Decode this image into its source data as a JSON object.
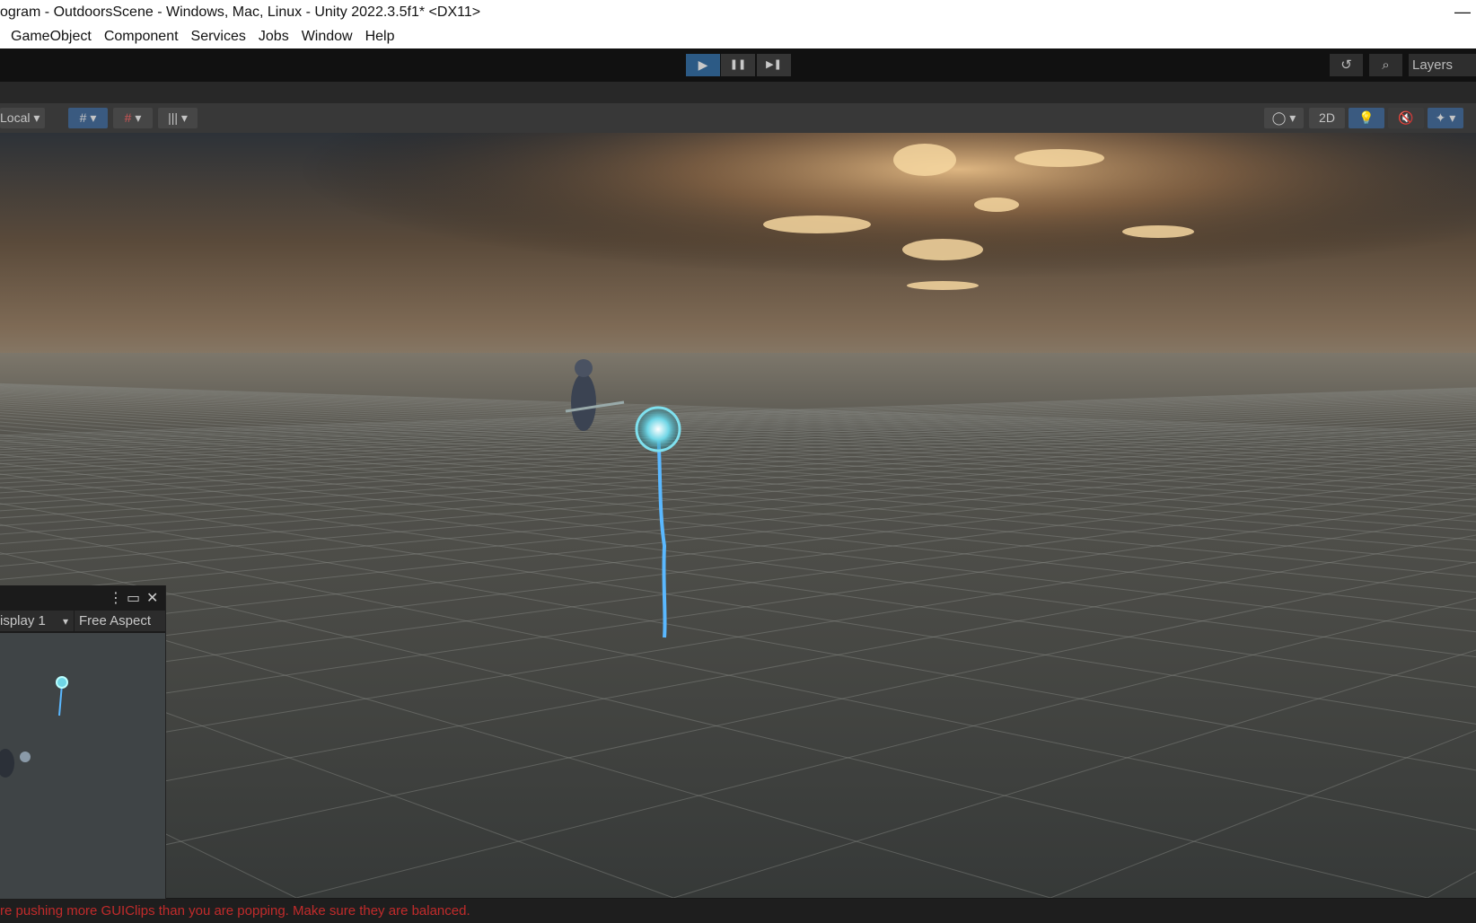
{
  "window": {
    "title": "ogram - OutdoorsScene - Windows, Mac, Linux - Unity 2022.3.5f1* <DX11>",
    "close_glyph": "—"
  },
  "menu": [
    "GameObject",
    "Component",
    "Services",
    "Jobs",
    "Window",
    "Help"
  ],
  "toolbar": {
    "play": "▶",
    "pause": "❚❚",
    "step": "▶❚",
    "history_icon": "↺",
    "search_icon": "⌕",
    "layers_label": "Layers"
  },
  "scene_toolbar": {
    "pivot_label": "Local",
    "view_2d": "2D",
    "dropdown": "▾"
  },
  "game_view": {
    "display": "isplay 1",
    "aspect": "Free Aspect",
    "menu_glyph": "⋮",
    "max_glyph": "▭",
    "close_glyph": "✕"
  },
  "console": {
    "message": "re pushing more GUIClips than you are popping. Make sure they are balanced."
  },
  "colors": {
    "accent": "#2c5a85",
    "error": "#c22b2b",
    "beam": "#5ab8ff"
  }
}
